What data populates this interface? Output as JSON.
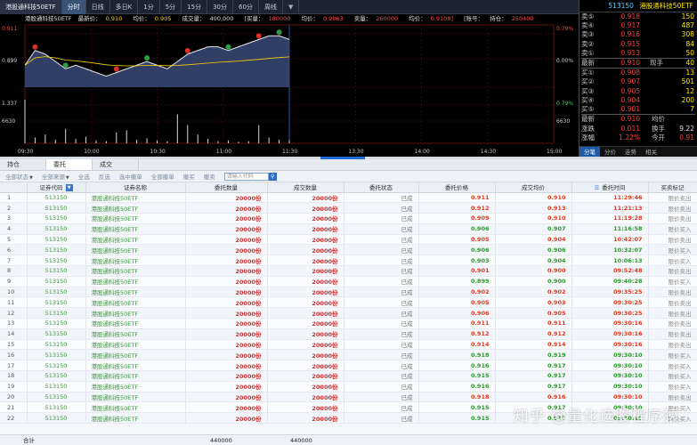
{
  "top_tabs": [
    "港股通科技50ETF",
    "分时",
    "日线",
    "多日K",
    "1分",
    "5分",
    "15分",
    "30分",
    "60分",
    "周线",
    "▼"
  ],
  "active_tab_index": 1,
  "info": {
    "name": "港股通科技50ETF",
    "latest_label": "最新价：",
    "latest": "0.910",
    "avg_label": "均价：",
    "avg": "0.905",
    "vol_label": "成交量：",
    "vol": "400,000",
    "buy_label": "[买量：",
    "buy": "180000",
    "avg2_label": "均价：",
    "avg2": "0.9063",
    "sell_label": "卖量：",
    "sell": "260000",
    "avg3_label": "均价：",
    "avg3": "0.9108]",
    "acct_label": "[账号：",
    "pos_label": "持仓：",
    "pos": "250400"
  },
  "chart_axis": {
    "left": [
      "0.911",
      "0.899",
      "1.337",
      "6630"
    ],
    "right": [
      "0.79%",
      "0.00%",
      "0.79%",
      "6630"
    ],
    "times": [
      "09:30",
      "10:00",
      "10:30",
      "11:00",
      "11:30",
      "13:30",
      "14:00",
      "14:30",
      "15:00"
    ]
  },
  "chart_data": {
    "type": "line",
    "x_start": "09:30",
    "x_end": "11:30",
    "price": [
      0.905,
      0.909,
      0.908,
      0.906,
      0.904,
      0.905,
      0.904,
      0.903,
      0.902,
      0.903,
      0.904,
      0.905,
      0.906,
      0.905,
      0.904,
      0.906,
      0.908,
      0.909,
      0.91,
      0.91,
      0.909,
      0.91,
      0.911,
      0.912,
      0.913,
      0.913,
      0.912
    ],
    "volume": [
      60,
      8,
      12,
      5,
      20,
      6,
      9,
      4,
      3,
      15,
      18,
      5,
      7,
      4,
      3,
      40,
      25,
      12,
      6,
      3,
      4,
      2,
      3,
      25,
      8,
      5,
      4
    ],
    "ylim": [
      0.899,
      0.915
    ]
  },
  "order_book": {
    "title_code": "513150",
    "title_name": "港股通科技50ETF",
    "asks": [
      {
        "label": "卖⑤",
        "price": "0.918",
        "vol": "150"
      },
      {
        "label": "卖④",
        "price": "0.917",
        "vol": "487"
      },
      {
        "label": "卖③",
        "price": "0.916",
        "vol": "308"
      },
      {
        "label": "卖②",
        "price": "0.915",
        "vol": "84"
      },
      {
        "label": "卖①",
        "price": "0.913",
        "vol": "50"
      }
    ],
    "last": {
      "label": "最新",
      "price": "0.910",
      "label2": "现手",
      "vol": "40"
    },
    "bids": [
      {
        "label": "买①",
        "price": "0.908",
        "vol": "13"
      },
      {
        "label": "买②",
        "price": "0.907",
        "vol": "501"
      },
      {
        "label": "买③",
        "price": "0.905",
        "vol": "12"
      },
      {
        "label": "买④",
        "price": "0.904",
        "vol": "200"
      },
      {
        "label": "买⑤",
        "price": "0.901",
        "vol": "7"
      }
    ],
    "stats": [
      {
        "l1": "最新",
        "v1": "0.910",
        "l2": "均价",
        "v2": ""
      },
      {
        "l1": "涨跌",
        "v1": "0.011",
        "l2": "换手",
        "v2": "9.22"
      },
      {
        "l1": "涨幅",
        "v1": "1.22%",
        "l2": "今开",
        "v2": "0.91"
      }
    ],
    "tabs": [
      "分笔",
      "分价",
      "走势",
      "相关"
    ]
  },
  "main_tabs": [
    "持仓",
    "委托",
    "成交"
  ],
  "active_main_tab": 1,
  "toolbar": {
    "status_filter": "全部状态",
    "source_filter": "全部来源",
    "b1": "全选",
    "b2": "反选",
    "b3": "选中撤单",
    "b4": "全部撤单",
    "b5": "撤买",
    "b6": "撤卖",
    "search_placeholder": "请输入代码"
  },
  "table": {
    "headers": [
      "",
      "证券代码",
      "证券名称",
      "委托数量",
      "成交数量",
      "委托状态",
      "委托价格",
      "成交均价",
      "委托时间",
      "买卖标记"
    ],
    "rows": [
      [
        "1",
        "513150",
        "港股通科技50ETF",
        "20000份",
        "20000份",
        "已成",
        "0.911",
        "0.910",
        "11:29:46",
        "限价卖出",
        "r"
      ],
      [
        "2",
        "513150",
        "港股通科技50ETF",
        "20000份",
        "20000份",
        "已成",
        "0.912",
        "0.913",
        "11:21:13",
        "限价卖出",
        "r"
      ],
      [
        "3",
        "513150",
        "港股通科技50ETF",
        "20000份",
        "20000份",
        "已成",
        "0.909",
        "0.910",
        "11:19:28",
        "限价卖出",
        "r"
      ],
      [
        "4",
        "513150",
        "港股通科技50ETF",
        "20000份",
        "20000份",
        "已成",
        "0.906",
        "0.907",
        "11:16:58",
        "限价买入",
        "g"
      ],
      [
        "5",
        "513150",
        "港股通科技50ETF",
        "20000份",
        "20000份",
        "已成",
        "0.905",
        "0.904",
        "10:42:07",
        "限价卖出",
        "r"
      ],
      [
        "6",
        "513150",
        "港股通科技50ETF",
        "20000份",
        "20000份",
        "已成",
        "0.906",
        "0.906",
        "10:32:07",
        "限价买入",
        "g"
      ],
      [
        "7",
        "513150",
        "港股通科技50ETF",
        "20000份",
        "20000份",
        "已成",
        "0.903",
        "0.904",
        "10:06:13",
        "限价买入",
        "g"
      ],
      [
        "8",
        "513150",
        "港股通科技50ETF",
        "20000份",
        "20000份",
        "已成",
        "0.901",
        "0.900",
        "09:52:48",
        "限价卖出",
        "r"
      ],
      [
        "9",
        "513150",
        "港股通科技50ETF",
        "20000份",
        "20000份",
        "已成",
        "0.899",
        "0.900",
        "09:40:28",
        "限价买入",
        "g"
      ],
      [
        "10",
        "513150",
        "港股通科技50ETF",
        "20000份",
        "20000份",
        "已成",
        "0.902",
        "0.902",
        "09:35:25",
        "限价卖出",
        "r"
      ],
      [
        "11",
        "513150",
        "港股通科技50ETF",
        "20000份",
        "20000份",
        "已成",
        "0.905",
        "0.903",
        "09:30:25",
        "限价卖出",
        "r"
      ],
      [
        "12",
        "513150",
        "港股通科技50ETF",
        "20000份",
        "20000份",
        "已成",
        "0.906",
        "0.905",
        "09:30:25",
        "限价卖出",
        "r"
      ],
      [
        "13",
        "513150",
        "港股通科技50ETF",
        "20000份",
        "20000份",
        "已成",
        "0.911",
        "0.911",
        "09:30:16",
        "限价卖出",
        "r"
      ],
      [
        "14",
        "513150",
        "港股通科技50ETF",
        "20000份",
        "20000份",
        "已成",
        "0.912",
        "0.912",
        "09:30:16",
        "限价卖出",
        "r"
      ],
      [
        "15",
        "513150",
        "港股通科技50ETF",
        "20000份",
        "20000份",
        "已成",
        "0.914",
        "0.914",
        "09:30:16",
        "限价卖出",
        "r"
      ],
      [
        "16",
        "513150",
        "港股通科技50ETF",
        "20000份",
        "20000份",
        "已成",
        "0.918",
        "0.919",
        "09:30:10",
        "限价买入",
        "g"
      ],
      [
        "17",
        "513150",
        "港股通科技50ETF",
        "20000份",
        "20000份",
        "已成",
        "0.916",
        "0.917",
        "09:30:10",
        "限价买入",
        "g"
      ],
      [
        "18",
        "513150",
        "港股通科技50ETF",
        "20000份",
        "20000份",
        "已成",
        "0.915",
        "0.917",
        "09:30:10",
        "限价买入",
        "g"
      ],
      [
        "19",
        "513150",
        "港股通科技50ETF",
        "20000份",
        "20000份",
        "已成",
        "0.916",
        "0.917",
        "09:30:10",
        "限价买入",
        "g"
      ],
      [
        "20",
        "513150",
        "港股通科技50ETF",
        "20000份",
        "20000份",
        "已成",
        "0.918",
        "0.916",
        "09:30:10",
        "限价卖出",
        "r"
      ],
      [
        "21",
        "513150",
        "港股通科技50ETF",
        "20000份",
        "20000份",
        "已成",
        "0.915",
        "0.917",
        "09:30:10",
        "限价买入",
        "g"
      ],
      [
        "22",
        "513150",
        "港股通科技50ETF",
        "20000份",
        "20000份",
        "已成",
        "0.915",
        "0.917",
        "09:30:10",
        "限价买入",
        "g"
      ]
    ],
    "totals_label": "合计",
    "total_order": "440000",
    "total_fill": "440000"
  },
  "watermark": "知乎 @量化选股程序猿",
  "colors": {
    "up": "#e03a1e",
    "down": "#2a9a2a",
    "accent": "#1e6ad6"
  }
}
